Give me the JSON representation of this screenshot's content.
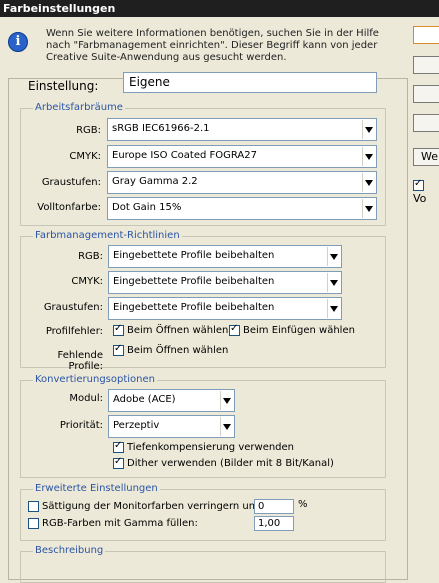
{
  "window": {
    "title": "Farbeinstellungen"
  },
  "info": {
    "icon": "info-icon",
    "line1": "Wenn Sie weitere Informationen benötigen, suchen Sie in der Hilfe",
    "line2": "nach \"Farbmanagement einrichten\". Dieser Begriff kann von jeder",
    "line3": "Creative Suite-Anwendung aus gesucht werden."
  },
  "right_buttons": {
    "button5_label": "We",
    "checkbox_label": "Vo"
  },
  "settings": {
    "label": "Einstellung:",
    "value": "Eigene"
  },
  "workspaces": {
    "title": "Arbeitsfarbräume",
    "rgb_label": "RGB:",
    "rgb_value": "sRGB IEC61966-2.1",
    "cmyk_label": "CMYK:",
    "cmyk_value": "Europe ISO Coated FOGRA27",
    "gray_label": "Graustufen:",
    "gray_value": "Gray Gamma 2.2",
    "spot_label": "Volltonfarbe:",
    "spot_value": "Dot Gain 15%"
  },
  "policies": {
    "title": "Farbmanagement-Richtlinien",
    "rgb_label": "RGB:",
    "rgb_value": "Eingebettete Profile beibehalten",
    "cmyk_label": "CMYK:",
    "cmyk_value": "Eingebettete Profile beibehalten",
    "gray_label": "Graustufen:",
    "gray_value": "Eingebettete Profile beibehalten",
    "mismatch_label": "Profilfehler:",
    "mismatch_open": "Beim Öffnen wählen",
    "mismatch_paste": "Beim Einfügen wählen",
    "missing_label": "Fehlende Profile:",
    "missing_open": "Beim Öffnen wählen"
  },
  "conversion": {
    "title": "Konvertierungsoptionen",
    "engine_label": "Modul:",
    "engine_value": "Adobe (ACE)",
    "intent_label": "Priorität:",
    "intent_value": "Perzeptiv",
    "bpc_label": "Tiefenkompensierung verwenden",
    "dither_label": "Dither verwenden (Bilder mit 8 Bit/Kanal)"
  },
  "advanced": {
    "title": "Erweiterte Einstellungen",
    "desaturate_label": "Sättigung der Monitorfarben verringern um:",
    "desaturate_value": "0",
    "desaturate_unit": "%",
    "blend_label": "RGB-Farben mit Gamma füllen:",
    "blend_value": "1,00"
  },
  "description": {
    "title": "Beschreibung"
  }
}
